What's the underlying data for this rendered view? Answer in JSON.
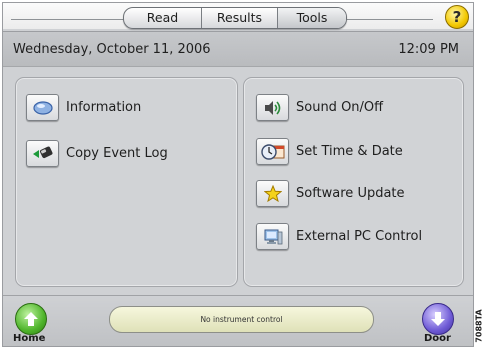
{
  "tabs": [
    {
      "label": "Read",
      "active": false
    },
    {
      "label": "Results",
      "active": false
    },
    {
      "label": "Tools",
      "active": true
    }
  ],
  "help_label": "?",
  "header": {
    "date": "Wednesday, October 11, 2006",
    "time": "12:09 PM"
  },
  "left_panel": [
    {
      "label": "Information",
      "icon": "information-icon"
    },
    {
      "label": "Copy Event Log",
      "icon": "copy-event-log-icon"
    }
  ],
  "right_panel": [
    {
      "label": "Sound On/Off",
      "icon": "sound-icon"
    },
    {
      "label": "Set Time & Date",
      "icon": "clock-calendar-icon"
    },
    {
      "label": "Software Update",
      "icon": "star-icon"
    },
    {
      "label": "External PC Control",
      "icon": "computer-icon"
    }
  ],
  "footer": {
    "home_label": "Home",
    "door_label": "Door",
    "status_text": "No instrument control"
  },
  "side_code": "7088TA"
}
